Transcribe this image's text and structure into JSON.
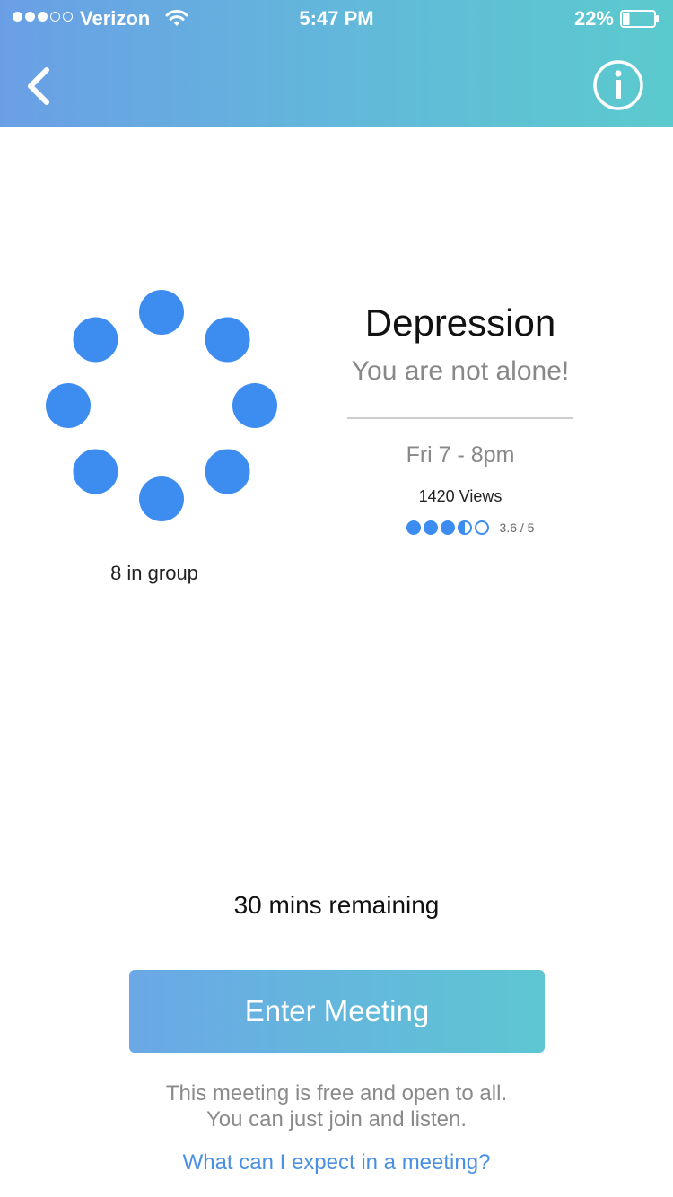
{
  "status_bar": {
    "signal_dots": [
      "full",
      "full",
      "full",
      "empty",
      "empty"
    ],
    "carrier": "Verizon",
    "wifi_icon": "wifi-icon",
    "time": "5:47 PM",
    "battery_percent": "22%",
    "battery_level": 0.22
  },
  "nav": {
    "back_icon": "chevron-left-icon",
    "info_icon": "info-icon"
  },
  "group": {
    "member_count": 8,
    "member_icon": "member-dot-icon",
    "count_label": "8 in group"
  },
  "meeting": {
    "title": "Depression",
    "subtitle": "You are not alone!",
    "schedule": "Fri 7 - 8pm",
    "views": "1420 Views",
    "rating": 3.6,
    "rating_max": 5,
    "rating_label": "3.6 / 5"
  },
  "footer": {
    "remaining": "30 mins remaining",
    "enter_button": "Enter Meeting",
    "note_line1": "This meeting is free and open to all.",
    "note_line2": "You can just join and listen.",
    "faq_link": "What can I expect in a meeting?"
  },
  "colors": {
    "header_start": "#6a9fe6",
    "header_end": "#5bcacd",
    "accent_blue": "#3d8cf0",
    "link_blue": "#4a90e2"
  }
}
